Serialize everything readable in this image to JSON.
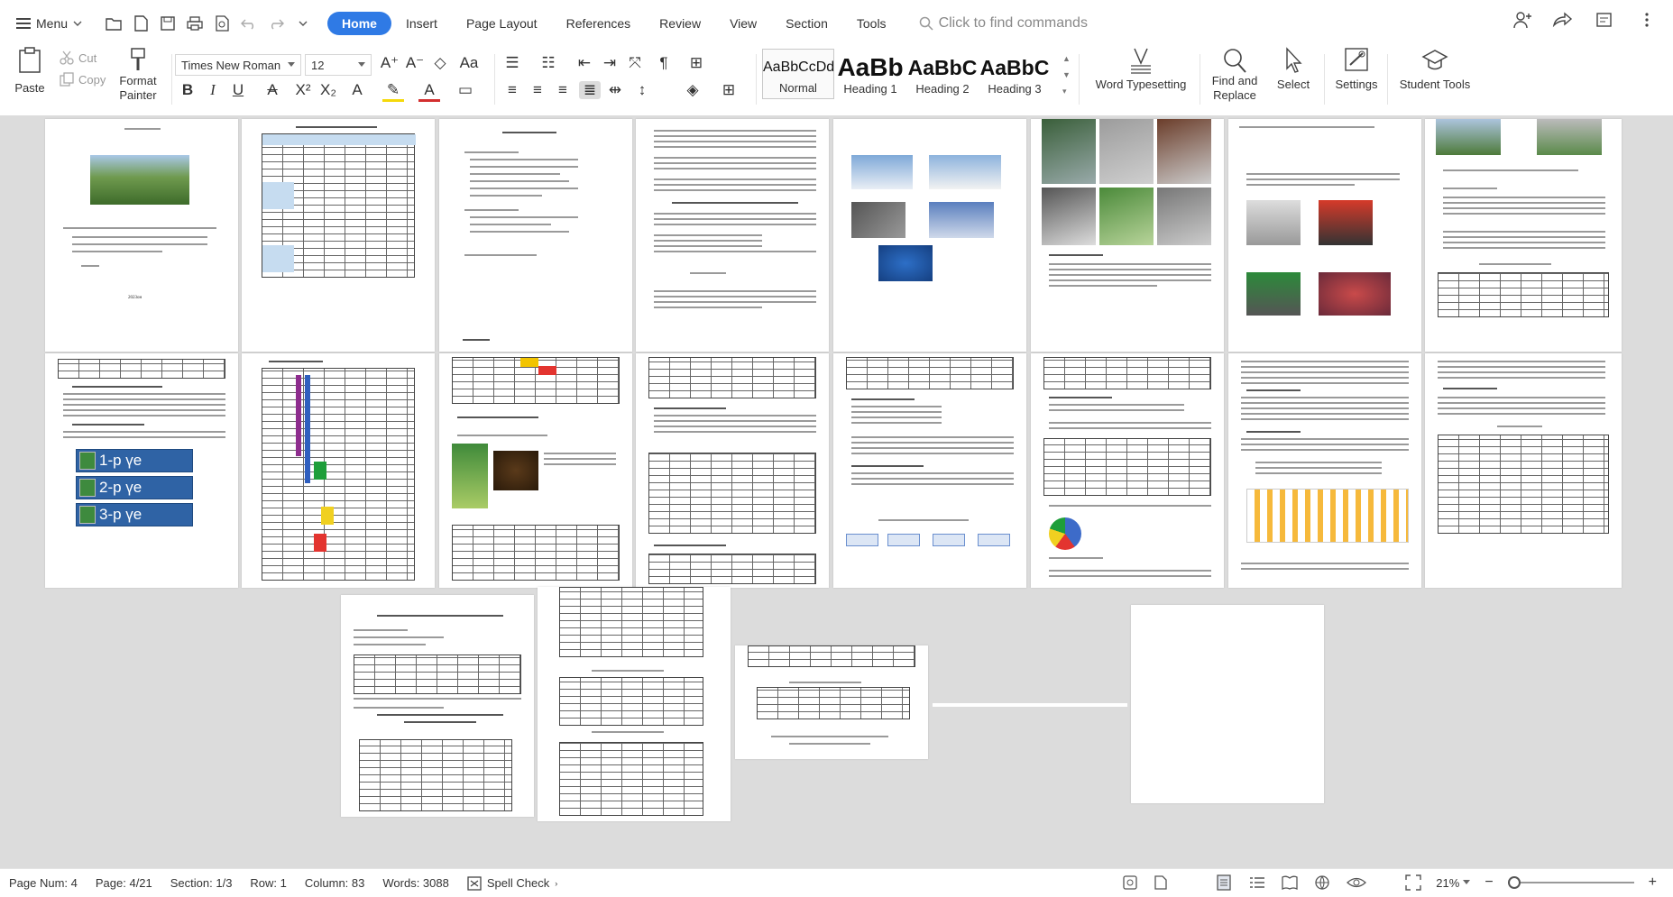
{
  "menubar": {
    "menu_label": "Menu",
    "tabs": [
      "Home",
      "Insert",
      "Page Layout",
      "References",
      "Review",
      "View",
      "Section",
      "Tools"
    ],
    "active_tab": "Home",
    "search_placeholder": "Click to find commands"
  },
  "ribbon": {
    "paste": "Paste",
    "cut": "Cut",
    "copy": "Copy",
    "format_painter_line1": "Format",
    "format_painter_line2": "Painter",
    "font_name": "Times New Roman",
    "font_size": "12",
    "styles": [
      {
        "preview": "AaBbCcDd",
        "label": "Normal"
      },
      {
        "preview": "AaBb",
        "label": "Heading 1"
      },
      {
        "preview": "AaBbC",
        "label": "Heading 2"
      },
      {
        "preview": "AaBbC",
        "label": "Heading 3"
      }
    ],
    "word_typesetting": "Word Typesetting",
    "find_replace_line1": "Find and",
    "find_replace_line2": "Replace",
    "select": "Select",
    "settings": "Settings",
    "student_tools": "Student Tools"
  },
  "document": {
    "tier_labels": [
      "1-р үе",
      "2-р үе",
      "3-р үе"
    ],
    "p1_footer": "2023он"
  },
  "status": {
    "page_num": "Page Num: 4",
    "page": "Page: 4/21",
    "section": "Section: 1/3",
    "row": "Row: 1",
    "column": "Column: 83",
    "words": "Words: 3088",
    "spell_check": "Spell Check",
    "zoom": "21%"
  },
  "colors": {
    "accent": "#2f7ae5",
    "workspace_bg": "#dcdcdc",
    "tier_blue": "#2f63a5"
  }
}
